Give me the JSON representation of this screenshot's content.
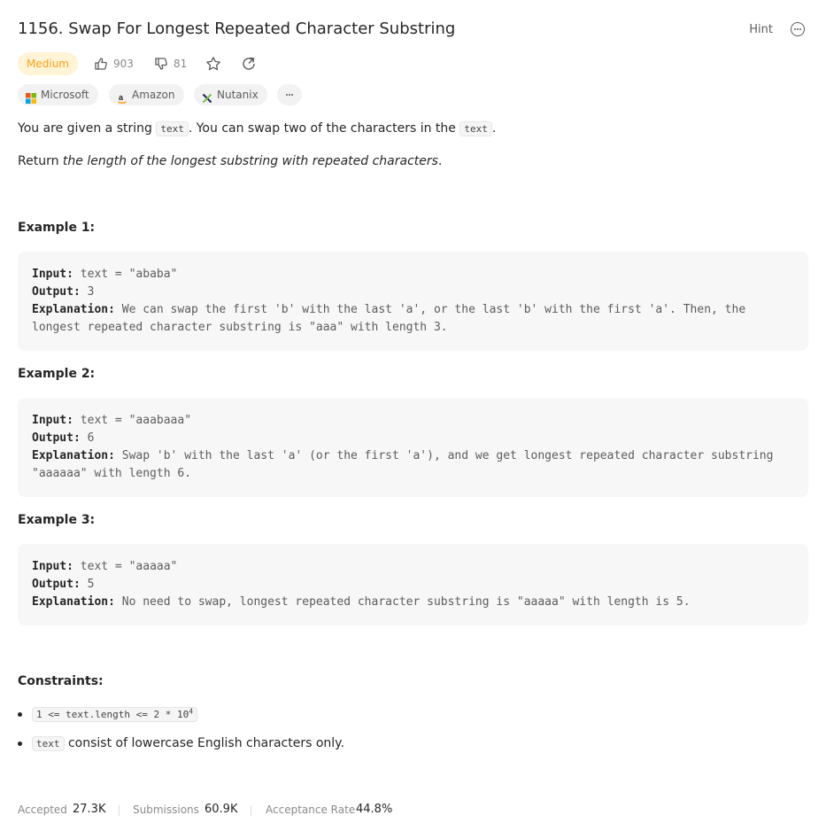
{
  "problem": {
    "title": "1156. Swap For Longest Repeated Character Substring",
    "hint_label": "Hint",
    "difficulty": "Medium",
    "likes": "903",
    "dislikes": "81"
  },
  "tags": [
    "Microsoft",
    "Amazon",
    "Nutanix"
  ],
  "description": {
    "p1_a": "You are given a string ",
    "p1_code1": "text",
    "p1_b": ". You can swap two of the characters in the ",
    "p1_code2": "text",
    "p1_c": ".",
    "p2_a": "Return ",
    "p2_em": "the length of the longest substring with repeated characters",
    "p2_b": "."
  },
  "examples": [
    {
      "heading": "Example 1:",
      "input_label": "Input:",
      "input": "text = \"ababa\"",
      "output_label": "Output:",
      "output": "3",
      "explanation_label": "Explanation:",
      "explanation_1": "We can swap the first 'b' with the last 'a', or the last 'b' with the first 'a'. Then, the",
      "explanation_2": "longest repeated character substring is \"aaa\" with length 3."
    },
    {
      "heading": "Example 2:",
      "input_label": "Input:",
      "input": "text = \"aaabaaa\"",
      "output_label": "Output:",
      "output": "6",
      "explanation_label": "Explanation:",
      "explanation_1": "Swap 'b' with the last 'a' (or the first 'a'), and we get longest repeated character substring",
      "explanation_2": "\"aaaaaa\" with length 6."
    },
    {
      "heading": "Example 3:",
      "input_label": "Input:",
      "input": "text = \"aaaaa\"",
      "output_label": "Output:",
      "output": "5",
      "explanation_label": "Explanation:",
      "explanation_1": "No need to swap, longest repeated character substring is \"aaaaa\" with length is 5.",
      "explanation_2": ""
    }
  ],
  "constraints": {
    "heading": "Constraints:",
    "c1_code": "1 <= text.length <= 2 * 10",
    "c1_sup": "4",
    "c2_code": "text",
    "c2_text": " consist of lowercase English characters only."
  },
  "stats": {
    "accepted_label": "Accepted",
    "accepted": "27.3K",
    "submissions_label": "Submissions",
    "submissions": "60.9K",
    "rate_label": "Acceptance Rate",
    "rate": "44.8%"
  },
  "colors": {
    "difficulty_medium": "#ffa116",
    "example_bg": "#f7f7f8"
  }
}
